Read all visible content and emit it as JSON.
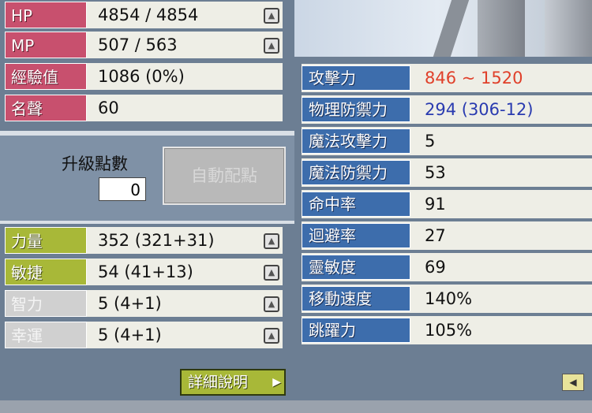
{
  "left_stats": [
    {
      "label": "HP",
      "value": "4854 / 4854",
      "style": "pink",
      "has_plus": true
    },
    {
      "label": "MP",
      "value": "507 / 563",
      "style": "pink",
      "has_plus": true
    },
    {
      "label": "經驗值",
      "value": "1086 (0%)",
      "style": "pink",
      "has_plus": false
    },
    {
      "label": "名聲",
      "value": "60",
      "style": "pink",
      "has_plus": false
    }
  ],
  "ability_points": {
    "label": "升級點數",
    "value": "0"
  },
  "auto_assign_label": "自動配點",
  "base_stats": [
    {
      "label": "力量",
      "value": "352 (321+31)",
      "style": "green"
    },
    {
      "label": "敏捷",
      "value": "54 (41+13)",
      "style": "green"
    },
    {
      "label": "智力",
      "value": "5 (4+1)",
      "style": "gray"
    },
    {
      "label": "幸運",
      "value": "5 (4+1)",
      "style": "gray"
    }
  ],
  "detail_button_label": "詳細說明",
  "detail_stats": [
    {
      "label": "攻擊力",
      "value": "846 ~ 1520",
      "color": "red"
    },
    {
      "label": "物理防禦力",
      "value": "294 (306-12)",
      "color": "blue"
    },
    {
      "label": "魔法攻擊力",
      "value": "5",
      "color": "black"
    },
    {
      "label": "魔法防禦力",
      "value": "53",
      "color": "black"
    },
    {
      "label": "命中率",
      "value": "91",
      "color": "black"
    },
    {
      "label": "迴避率",
      "value": "27",
      "color": "black"
    },
    {
      "label": "靈敏度",
      "value": "69",
      "color": "black"
    },
    {
      "label": "移動速度",
      "value": "140%",
      "color": "black"
    },
    {
      "label": "跳躍力",
      "value": "105%",
      "color": "black"
    }
  ],
  "colors": {
    "pink": "#c8506e",
    "green": "#a8b838",
    "blue_label": "#3d6dac",
    "red_value": "#e0402a",
    "blue_value": "#2a3bb0"
  },
  "icons": {
    "plus": "arrow-up-icon",
    "collapse": "arrow-left-icon"
  }
}
